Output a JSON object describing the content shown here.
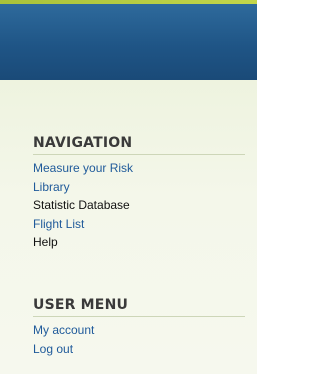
{
  "navigation": {
    "title": "NAVIGATION",
    "items": [
      {
        "label": "Measure your Risk"
      },
      {
        "label": "Library"
      },
      {
        "label": "Statistic Database"
      },
      {
        "label": "Flight List"
      },
      {
        "label": "Help"
      }
    ]
  },
  "user_menu": {
    "title": "USER MENU",
    "items": [
      {
        "label": "My account"
      },
      {
        "label": "Log out"
      }
    ]
  },
  "colors": {
    "header_blue": "#1f5586",
    "accent_green": "#a9c23a",
    "link_blue": "#1f5a9a"
  }
}
